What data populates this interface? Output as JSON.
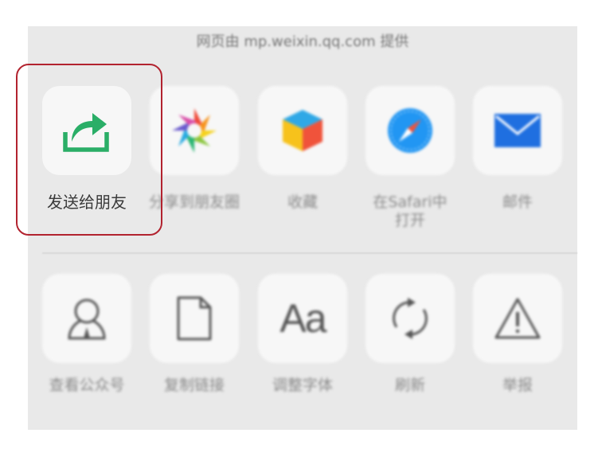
{
  "sheet": {
    "title": "网页由 mp.weixin.qq.com 提供"
  },
  "share_row": [
    {
      "label": "发送给朋友",
      "icon": "share-arrow-icon"
    },
    {
      "label": "分享到朋友圈",
      "icon": "moments-icon"
    },
    {
      "label": "收藏",
      "icon": "favorite-cube-icon"
    },
    {
      "label": "在Safari中",
      "label2": "打开",
      "icon": "safari-compass-icon"
    },
    {
      "label": "邮件",
      "icon": "mail-icon"
    }
  ],
  "action_row": [
    {
      "label": "查看公众号",
      "icon": "official-account-icon"
    },
    {
      "label": "复制链接",
      "icon": "copy-link-icon"
    },
    {
      "label": "调整字体",
      "icon": "font-size-icon",
      "glyph": "Aa"
    },
    {
      "label": "刷新",
      "icon": "refresh-icon"
    },
    {
      "label": "举报",
      "icon": "report-warning-icon"
    }
  ],
  "colors": {
    "accent_green": "#2aae67",
    "highlight_border": "#b2232f",
    "mail_blue": "#1f6fe0",
    "safari_blue": "#2196f3"
  }
}
